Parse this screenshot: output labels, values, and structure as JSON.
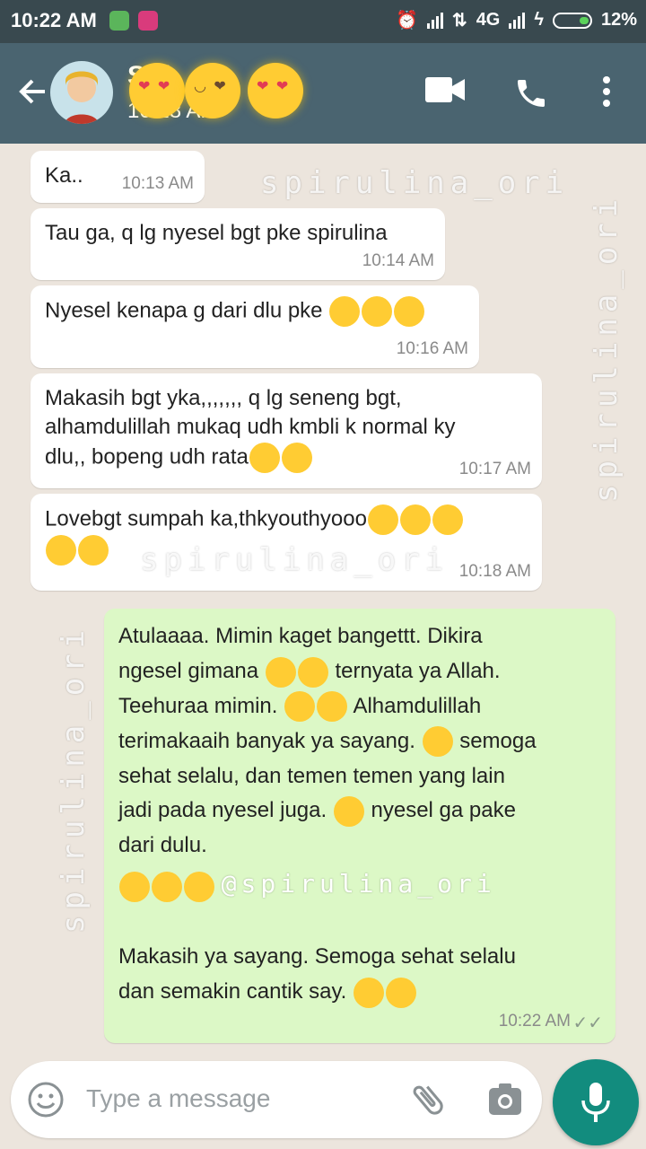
{
  "status_bar": {
    "time": "10:22 AM",
    "network": "4G",
    "battery": "12%"
  },
  "header": {
    "contact_name": "S    ri",
    "last_seen": "10:18 AM",
    "icons": [
      "back-arrow-icon",
      "video-call-icon",
      "phone-icon",
      "more-vert-icon"
    ]
  },
  "messages": [
    {
      "text": "Ka..",
      "time": "10:13 AM"
    },
    {
      "text": "Tau ga, q lg nyesel bgt pke spirulina",
      "time": "10:14 AM"
    },
    {
      "text": "Nyesel kenapa g dari dlu pke",
      "time": "10:16 AM"
    },
    {
      "line1": "Makasih bgt yka,,,,,,, q lg seneng bgt,",
      "line2": "alhamdulillah mukaq udh kmbli k normal ky",
      "line3": "dlu,, bopeng udh rata",
      "time": "10:17 AM"
    },
    {
      "text": "Lovebgt sumpah ka,thkyouthyooo",
      "time": "10:18 AM"
    }
  ],
  "outgoing": {
    "l1": "Atulaaaa. Mimin kaget bangettt. Dikira",
    "l2a": "ngesel gimana",
    "l2b": "ternyata ya Allah.",
    "l3a": "Teehuraa mimin.",
    "l3b": "Alhamdulillah",
    "l4a": "terimakaaih banyak ya sayang.",
    "l4b": "semoga",
    "l5": "sehat selalu, dan temen temen yang lain",
    "l6a": "jadi pada nyesel juga.",
    "l6b": "nyesel ga pake",
    "l7": "dari dulu.",
    "l8": "@spirulina_ori",
    "l9": "Makasih ya sayang. Semoga sehat selalu",
    "l10": "dan semakin cantik say.",
    "time": "10:22 AM"
  },
  "watermarks": [
    "spirulina_ori",
    "spirulina_ori",
    "spirulina_ori",
    "spirulina_ori"
  ],
  "composer": {
    "placeholder": "Type a message"
  },
  "colors": {
    "header": "#4a6470",
    "outgoing_bubble": "#dcf8c6",
    "mic": "#128c7e"
  }
}
